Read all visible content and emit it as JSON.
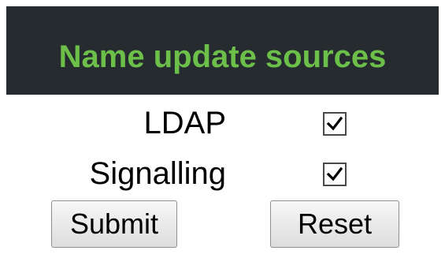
{
  "form": {
    "title": "Name update sources",
    "options": [
      {
        "label": "LDAP",
        "checked": true
      },
      {
        "label": "Signalling",
        "checked": true
      }
    ],
    "submit_label": "Submit",
    "reset_label": "Reset"
  },
  "colors": {
    "panel_background": "#262b30",
    "title_text": "#6cc04a"
  },
  "icons": {
    "checkbox_checked": "checkmark-icon"
  }
}
